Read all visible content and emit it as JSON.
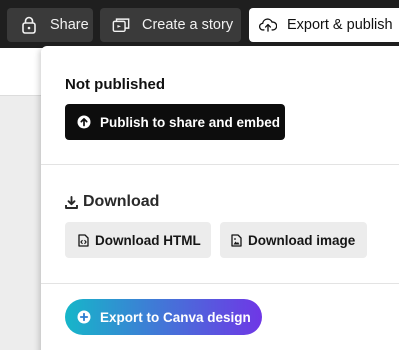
{
  "toolbar": {
    "share": {
      "label": "Share",
      "icon": "lock-icon"
    },
    "story": {
      "label": "Create a story",
      "icon": "story-icon"
    },
    "export": {
      "label": "Export & publish",
      "icon": "cloud-upload-icon"
    }
  },
  "panel": {
    "publish_section": {
      "title": "Not published",
      "button_label": "Publish to share and embed",
      "button_icon": "upload-circle-icon"
    },
    "download_section": {
      "title": "Download",
      "title_icon": "download-icon",
      "html_button": {
        "label": "Download HTML",
        "icon": "html-file-icon"
      },
      "image_button": {
        "label": "Download image",
        "icon": "image-file-icon"
      }
    },
    "canva_section": {
      "button_label": "Export to Canva design",
      "button_icon": "plus-circle-icon"
    }
  },
  "colors": {
    "toolbar_bg": "#1f1f1f",
    "toolbar_button_bg": "#3a3a3a",
    "publish_button_bg": "#0d0d0d",
    "download_button_bg": "#ececec",
    "canva_gradient_start": "#16b6c9",
    "canva_gradient_end": "#6f37e6"
  }
}
